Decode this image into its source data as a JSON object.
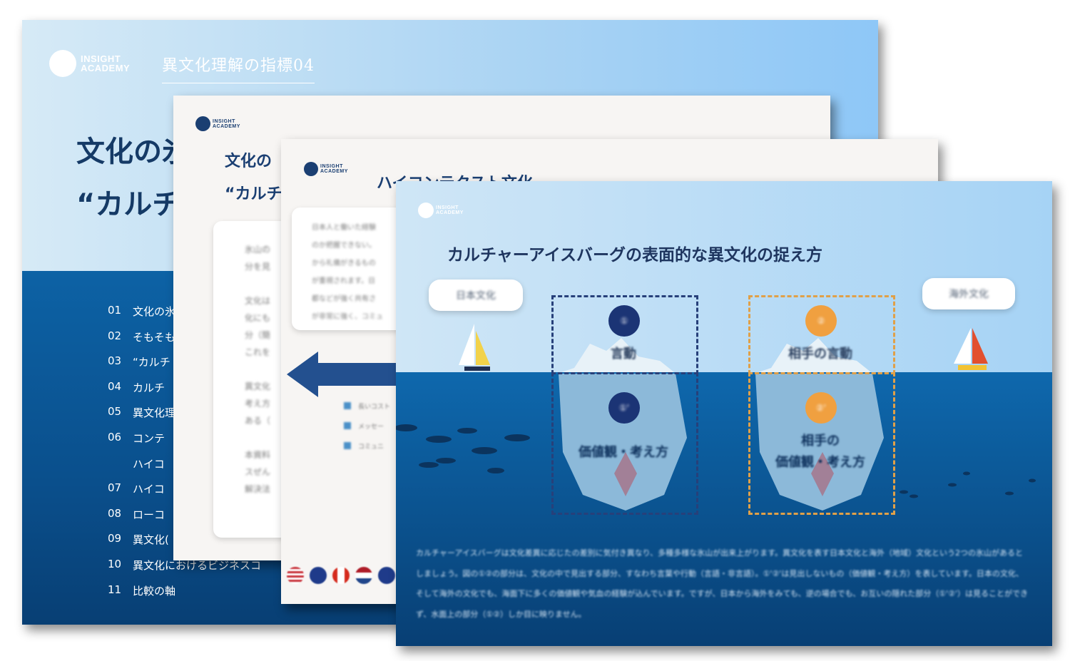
{
  "slide_main": {
    "logo_line1": "INSIGHT",
    "logo_line2": "ACADEMY",
    "indicator": "異文化理解の指標04",
    "title_line1": "文化の氷",
    "title_line2": "“カルチ",
    "toc": [
      {
        "num": "01",
        "label": "文化の氷"
      },
      {
        "num": "02",
        "label": "そもそも"
      },
      {
        "num": "03",
        "label": "“カルチ"
      },
      {
        "num": "04",
        "label": "カルチ"
      },
      {
        "num": "05",
        "label": "異文化理"
      },
      {
        "num": "06",
        "label": "コンテ"
      },
      {
        "num": "",
        "label": "ハイコ"
      },
      {
        "num": "07",
        "label": "ハイコ"
      },
      {
        "num": "08",
        "label": "ローコ"
      },
      {
        "num": "09",
        "label": "異文化("
      },
      {
        "num": "10",
        "label": "異文化におけるビジネスコ"
      },
      {
        "num": "11",
        "label": "比較の軸"
      }
    ]
  },
  "slide_second": {
    "logo_line1": "INSIGHT",
    "logo_line2": "ACADEMY",
    "title_line1": "文化の",
    "title_line2": "“カルチ",
    "card_text": "氷山の\n分を見\n\n文化は\n化にも\n分（簡\nこれを\n\n異文化\n考え方\nある（\n\n本資料\nスぜん\n解決法"
  },
  "slide_third": {
    "logo_line1": "INSIGHT",
    "logo_line2": "ACADEMY",
    "title": "ハイコンテクスト文化",
    "card_text": "日本人と働いた経験\nのか把握できない。\nから礼儀がきるもの\nが重視されます。日\n都などが強く共有さ\nが非常に強く、コミュ",
    "bullets": [
      "長いコスト",
      "メッセー",
      "コミュニ"
    ]
  },
  "slide_front": {
    "logo_line1": "INSIGHT",
    "logo_line2": "ACADEMY",
    "title": "カルチャーアイスバーグの表面的な異文化の捉え方",
    "label_japan": "日本文化",
    "label_foreign": "海外文化",
    "circle_1": "①",
    "circle_2": "②",
    "circle_1b": "①'",
    "circle_2b": "②'",
    "left_top_label": "言動",
    "left_bottom_label": "価値観・考え方",
    "right_top_label": "相手の言動",
    "right_bottom_line1": "相手の",
    "right_bottom_line2": "価値観・考え方",
    "paragraph": "カルチャーアイスバーグは文化差異に応じたの差別に気付き異なり、多種多様な氷山が出来上がります。異文化を表す日本文化と海外（地域）文化という2つの氷山があるとしましょう。図の①②の部分は、文化の中で見出する部分、すなわち言葉や行動（言語・非言語）。①'②'は見出しないもの（価値観・考え方）を表しています。日本の文化、そして海外の文化でも、海面下に多くの価値観や気血の経験が込んでいます。ですが、日本から海外をみても、逆の場合でも、お互いの隠れた部分（①'②'）は見ることができず、水面上の部分（①②）しか目に映りません。",
    "colors": {
      "navy": "#1b3475",
      "orange": "#f0a040",
      "sea": "#0a4f8c",
      "sky": "#bfe0f7"
    }
  }
}
